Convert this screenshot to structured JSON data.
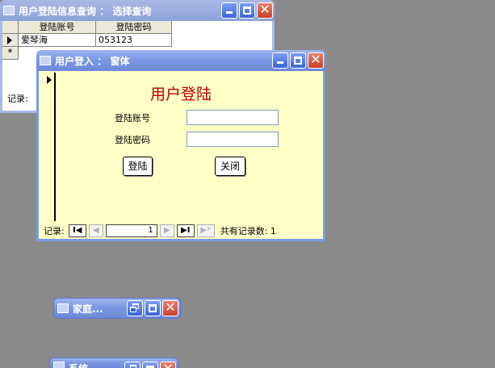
{
  "query_window": {
    "title": "用户登陆信息查询 ： 选择查询",
    "columns": [
      "登陆账号",
      "登陆密码"
    ],
    "rows": [
      {
        "account": "爱琴海",
        "password": "053123"
      }
    ],
    "new_row_marker": "*",
    "record_label": "记录:"
  },
  "login_form": {
    "title": "用户登入 ： 窗体",
    "heading": "用户登陆",
    "account_label": "登陆账号",
    "password_label": "登陆密码",
    "account_value": "",
    "password_value": "",
    "login_button": "登陆",
    "close_button": "关闭",
    "nav": {
      "record_label": "记录:",
      "current_record": "1",
      "total_label": "共有记录数: 1"
    }
  },
  "minimized_windows": [
    {
      "title": "家庭..."
    },
    {
      "title": "系统..."
    }
  ],
  "colors": {
    "titlebar": "#7d98e3",
    "form_background": "#ffffc8",
    "heading": "#c00000",
    "desktop": "#8a8a8a"
  }
}
